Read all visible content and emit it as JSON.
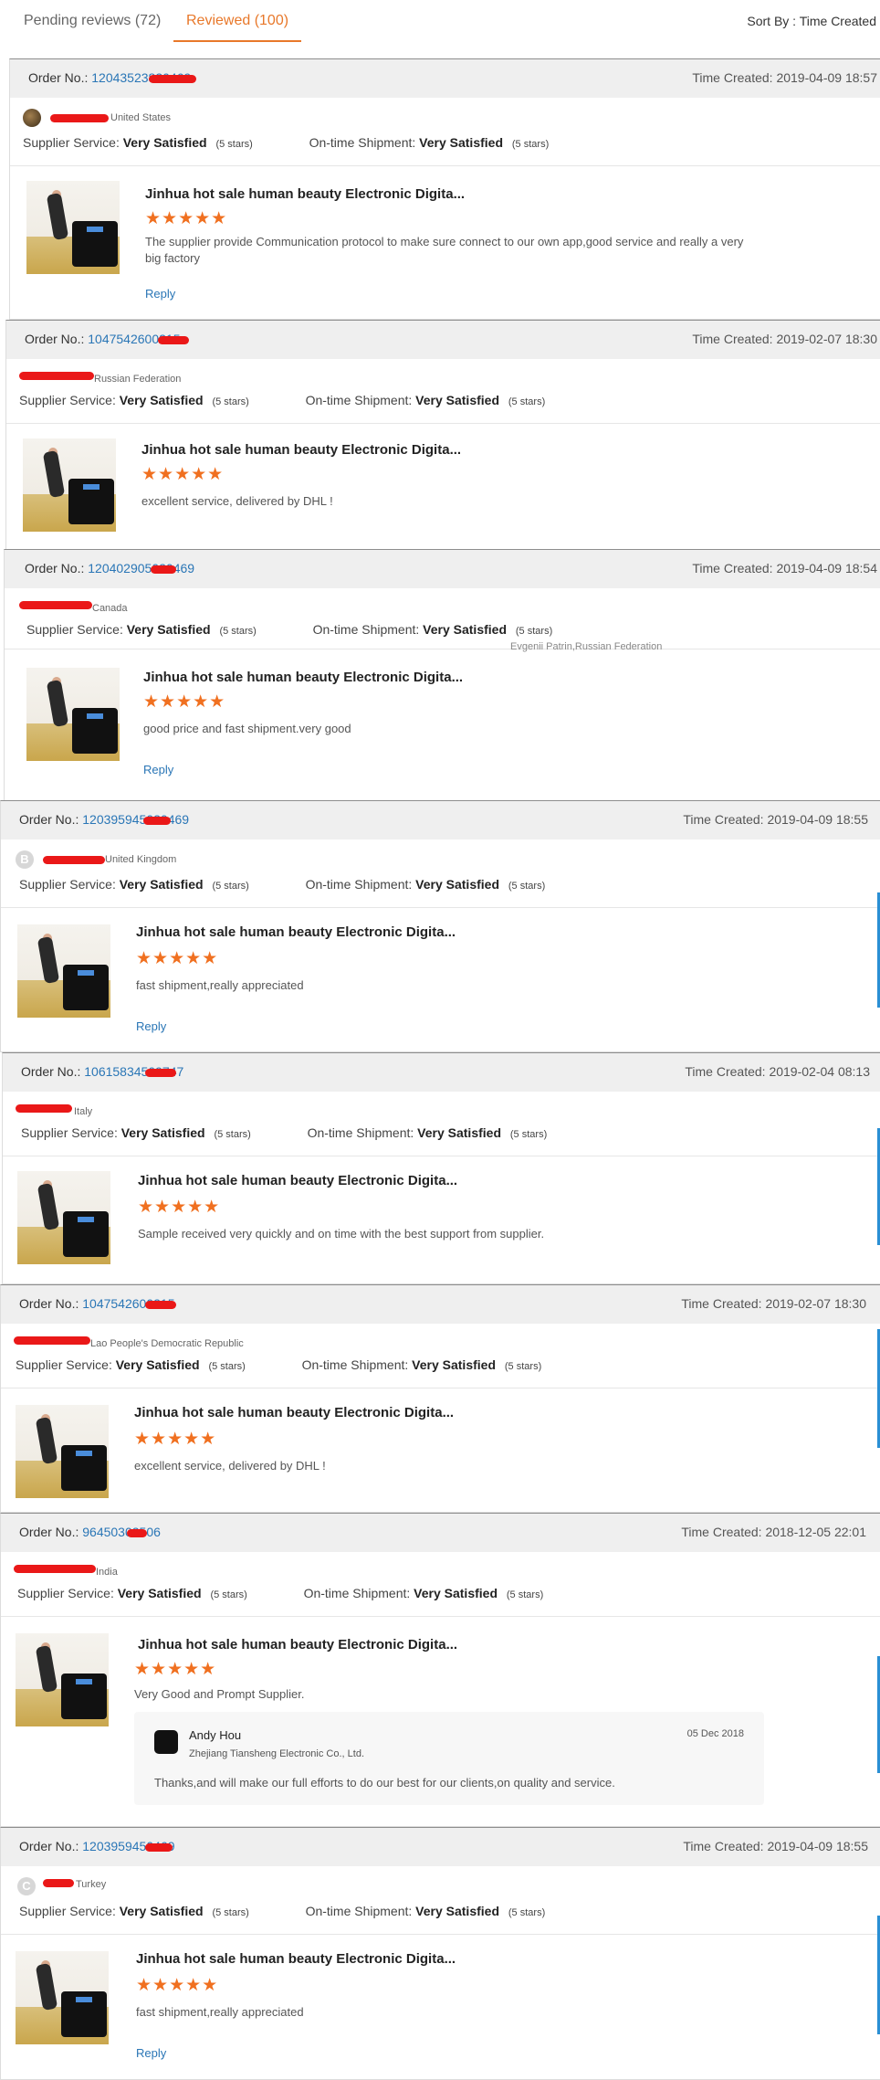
{
  "tabs": {
    "pending": "Pending reviews (72)",
    "reviewed": "Reviewed (100)"
  },
  "sort_by": "Sort By : Time Created",
  "order_label": "Order No.:",
  "time_label": "Time Created:",
  "supplier_label": "Supplier Service:",
  "shipment_label": "On-time Shipment:",
  "satisfied": "Very Satisfied",
  "five_stars": "(5 stars)",
  "star_glyphs": "★★★★★",
  "product_title": "Jinhua hot sale human beauty Electronic Digita...",
  "reply_label": "Reply",
  "floating_name": "Evgenii Patrin,Russian Federation",
  "colors": {
    "accent": "#e8782a",
    "link": "#2a76b6",
    "star": "#f07020",
    "redaction": "#ea1818"
  },
  "orders": [
    {
      "order_a": "120435238",
      "order_b": "20469",
      "time": "2019-04-09 18:57",
      "country": "United States",
      "avatar": "",
      "comment": "The supplier provide Communication protocol to make sure connect to our own app,good service and really a very big factory"
    },
    {
      "order_a": "1047542600",
      "order_b": "215",
      "time": "2019-02-07 18:30",
      "country": "Russian Federation",
      "avatar": "",
      "comment": "excellent service, delivered by DHL !"
    },
    {
      "order_a": "1204029050",
      "order_b": "20469",
      "time": "2019-04-09 18:54",
      "country": "Canada",
      "avatar": "",
      "comment": "good price and fast shipment.very good"
    },
    {
      "order_a": "1203959450",
      "order_b": "20469",
      "time": "2019-04-09 18:55",
      "country": "United Kingdom",
      "avatar": "B",
      "comment": "fast shipment,really appreciated"
    },
    {
      "order_a": "1061583450",
      "order_b": "9747",
      "time": "2019-02-04 08:13",
      "country": "Italy",
      "avatar": "",
      "comment": "Sample received very quickly and on time with the best support from supplier."
    },
    {
      "order_a": "1047542600",
      "order_b": "215",
      "time": "2019-02-07 18:30",
      "country": "Lao People's Democratic Republic",
      "avatar": "",
      "comment": "excellent service, delivered by DHL !"
    },
    {
      "order_a": "9645030",
      "order_b": "2506",
      "time": "2018-12-05 22:01",
      "country": "India",
      "avatar": "",
      "comment": "Very Good and Prompt Supplier."
    },
    {
      "order_a": "1203959450",
      "order_b": "469",
      "time": "2019-04-09 18:55",
      "country": "Turkey",
      "avatar": "C",
      "comment": "fast shipment,really appreciated"
    }
  ],
  "seller_reply": {
    "name": "Andy Hou",
    "company": "Zhejiang Tiansheng Electronic Co., Ltd.",
    "date": "05 Dec 2018",
    "text": "Thanks,and will make our full efforts to do our best for our clients,on quality and service."
  }
}
